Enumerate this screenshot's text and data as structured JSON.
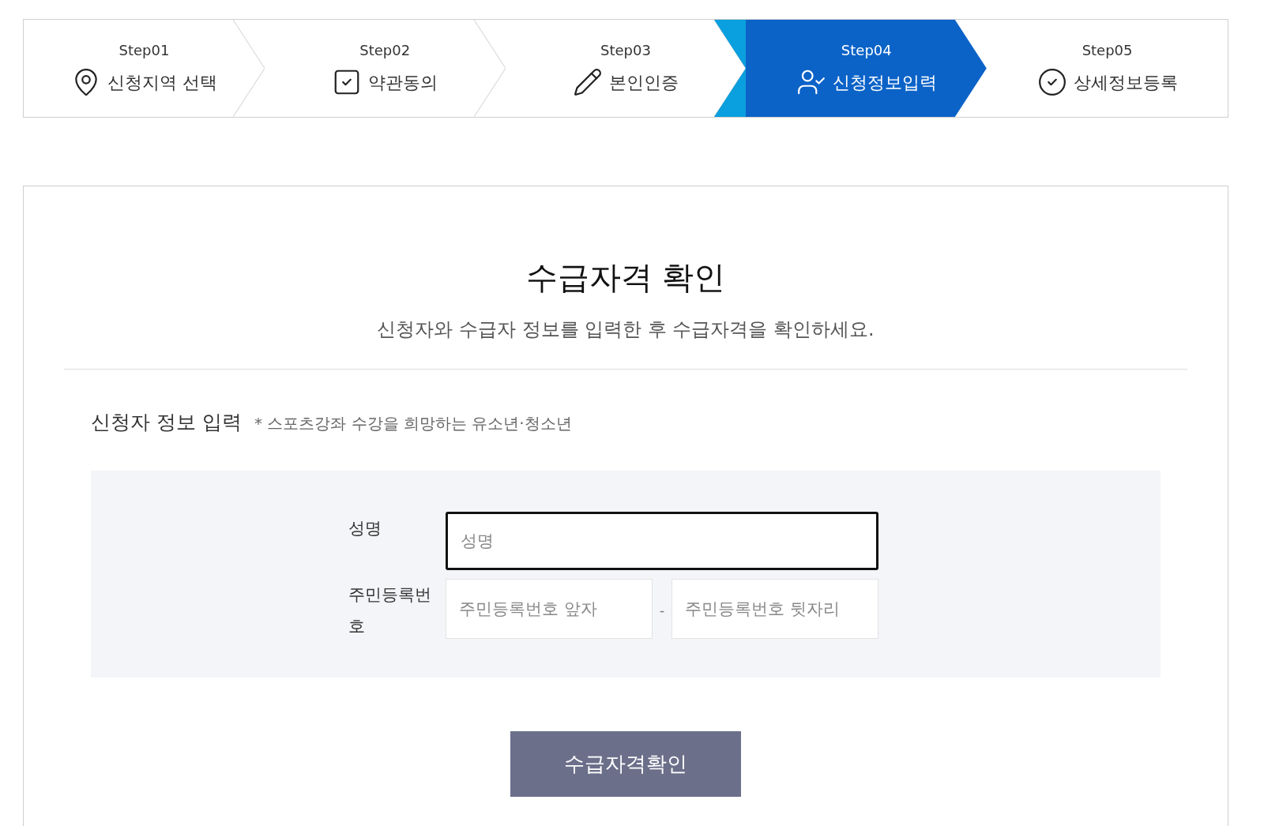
{
  "steps": [
    {
      "step": "Step01",
      "label": "신청지역 선택",
      "selected": false
    },
    {
      "step": "Step02",
      "label": "약관동의",
      "selected": false
    },
    {
      "step": "Step03",
      "label": "본인인증",
      "selected": false
    },
    {
      "step": "Step04",
      "label": "신청정보입력",
      "selected": true
    },
    {
      "step": "Step05",
      "label": "상세정보등록",
      "selected": false
    }
  ],
  "title": "수급자격 확인",
  "subtitle": "신청자와 수급자 정보를 입력한 후 수급자격을 확인하세요.",
  "section": {
    "title": "신청자 정보 입력",
    "note": "* 스포츠강좌 수강을 희망하는 유소년·청소년"
  },
  "form": {
    "name": {
      "label": "성명",
      "placeholder": "성명",
      "focused": true
    },
    "rrn": {
      "label": "주민등록번호",
      "front_placeholder": "주민등록번호 앞자",
      "separator": "-",
      "back_placeholder": "주민등록번호 뒷자리"
    }
  },
  "submit": "수급자격확인"
}
